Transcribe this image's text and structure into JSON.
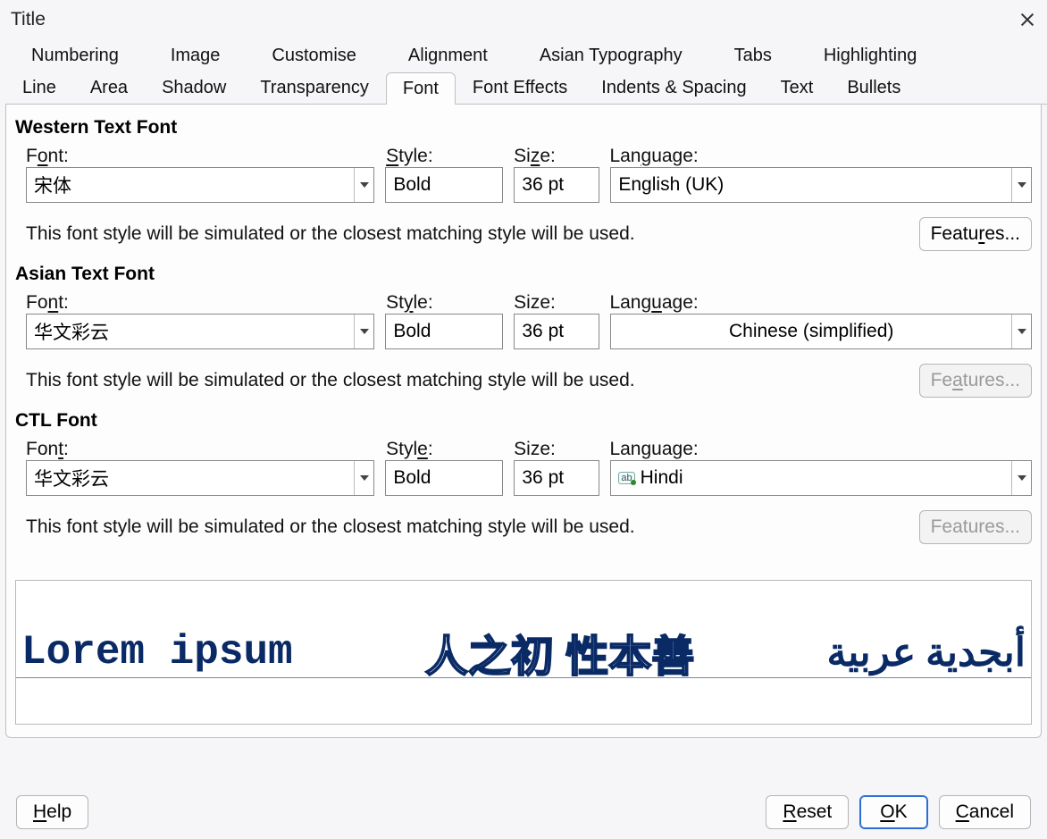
{
  "window": {
    "title": "Title"
  },
  "tabs": {
    "row1": [
      "Numbering",
      "Image",
      "Customise",
      "Alignment",
      "Asian Typography",
      "Tabs",
      "Highlighting"
    ],
    "row2": [
      "Line",
      "Area",
      "Shadow",
      "Transparency",
      "Font",
      "Font Effects",
      "Indents & Spacing",
      "Text",
      "Bullets"
    ],
    "active": "Font"
  },
  "labels": {
    "western_title": "Western Text Font",
    "asian_title": "Asian Text Font",
    "ctl_title": "CTL Font",
    "font": "Font:",
    "style": "Style:",
    "size": "Size:",
    "lang": "Language:",
    "note": "This font style will be simulated or the closest matching style will be used.",
    "features": "Features..."
  },
  "underline": {
    "font_o": "o",
    "style_s": "S",
    "size_z": "z",
    "lang_g": "g",
    "font_n": "n",
    "style_y": "y",
    "lang_u": "u",
    "font_t": "t",
    "style_e": "e",
    "features_r": "r",
    "features_a": "a",
    "help_h": "H",
    "reset_r": "R",
    "ok_o": "O",
    "cancel_c": "C"
  },
  "western": {
    "font": "宋体",
    "style": "Bold",
    "size": "36 pt",
    "lang": "English (UK)",
    "features_enabled": true
  },
  "asian": {
    "font": "华文彩云",
    "style": "Bold",
    "size": "36 pt",
    "lang": "Chinese (simplified)",
    "features_enabled": false
  },
  "ctl": {
    "font": "华文彩云",
    "style": "Bold",
    "size": "36 pt",
    "lang": "Hindi",
    "features_enabled": false,
    "lang_icon": "ab"
  },
  "preview": {
    "western": "Lorem ipsum",
    "asian": "人之初 性本善",
    "ctl": "أبجدية عربية"
  },
  "buttons": {
    "help": "Help",
    "reset": "Reset",
    "ok": "OK",
    "cancel": "Cancel"
  }
}
